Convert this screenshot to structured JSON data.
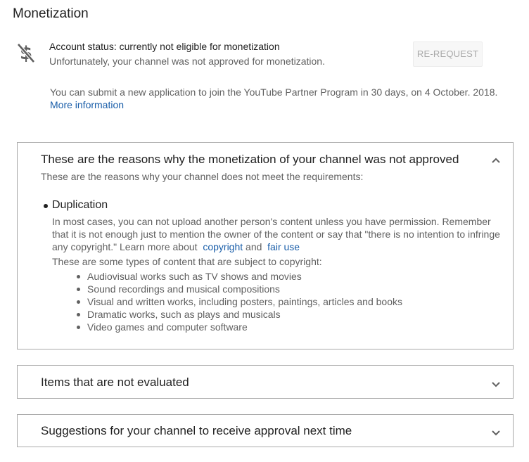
{
  "page": {
    "title": "Monetization"
  },
  "status": {
    "icon": "no-money-icon",
    "title": "Account status: currently not eligible for monetization",
    "subtitle": "Unfortunately, your channel was not approved for monetization.",
    "rerequest_label": "RE-REQUEST",
    "notice": "You can submit a new application to join the YouTube Partner Program in 30 days, on 4 October. 2018.",
    "more_info_label": "More information"
  },
  "panels": [
    {
      "title": "These are the reasons why the monetization of your channel was not approved",
      "expanded": true,
      "chevron_icon": "chevron-up-icon",
      "subtitle": "These are the reasons why your channel does not meet the requirements:",
      "reasons": [
        {
          "title": "Duplication",
          "body_before": "In most cases, you can not upload another person's content unless you have permission. Remember that it is not enough just to mention the owner of the content or say that \"there is no intention to infringe any copyright.\" Learn more about",
          "link_copyright": "copyright",
          "body_and": "and",
          "link_fair_use": "fair use",
          "types_intro": "These are some types of content that are subject to copyright:",
          "types": [
            "Audiovisual works such as TV shows and movies",
            "Sound recordings and musical compositions",
            "Visual and written works, including posters, paintings, articles and books",
            "Dramatic works, such as plays and musicals",
            "Video games and computer software"
          ]
        }
      ]
    },
    {
      "title": "Items that are not evaluated",
      "expanded": false,
      "chevron_icon": "chevron-down-icon"
    },
    {
      "title": "Suggestions for your channel to receive approval next time",
      "expanded": false,
      "chevron_icon": "chevron-down-icon"
    }
  ],
  "colors": {
    "text_primary": "#212121",
    "text_secondary": "#606060",
    "link": "#1a5ea9",
    "border": "#a9a9a9",
    "button_text_disabled": "#a8a8a8"
  }
}
